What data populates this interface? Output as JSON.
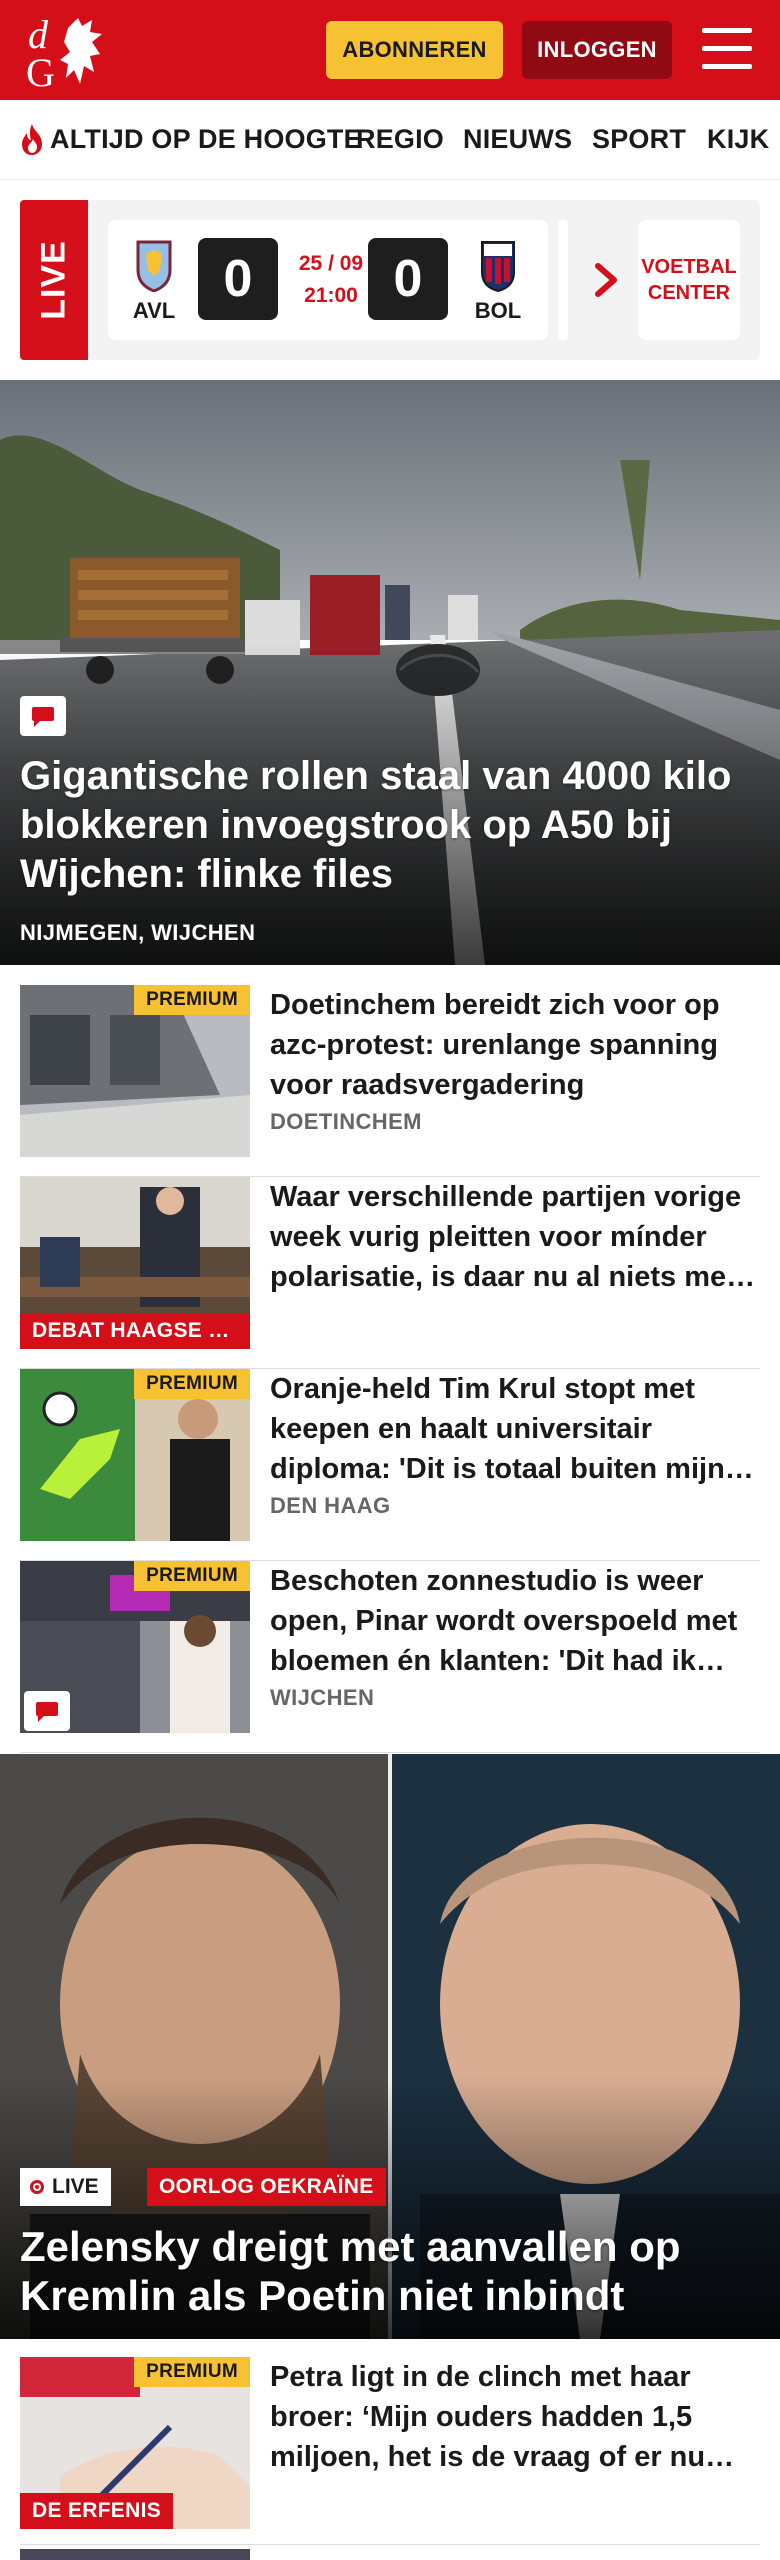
{
  "header": {
    "logo_text": "dG",
    "subscribe_label": "ABONNEREN",
    "login_label": "INLOGGEN",
    "brand_color": "#d50f1a",
    "accent_color": "#f6c234"
  },
  "nav": {
    "items": [
      {
        "label": "ALTIJD OP DE HOOGTE",
        "icon": "fire-icon"
      },
      {
        "label": "REGIO"
      },
      {
        "label": "NIEUWS"
      },
      {
        "label": "SPORT"
      },
      {
        "label": "KIJK"
      }
    ]
  },
  "live": {
    "tag": "LIVE",
    "match": {
      "home_abbr": "AVL",
      "home_score": "0",
      "date": "25 / 09",
      "time": "21:00",
      "away_score": "0",
      "away_abbr": "BOL"
    },
    "voetbal_center": "VOETBAL CENTER"
  },
  "hero": {
    "title": "Gigantische rollen staal van 4000 kilo blokkeren invoegstrook op A50 bij Wijchen: flinke files",
    "location": "NIJMEGEN, WIJCHEN",
    "icon": "comment-icon"
  },
  "articles": [
    {
      "title": "Doetinchem bereidt zich voor op azc-protest: urenlange spanning voor raadsvergadering",
      "location": "DOETINCHEM",
      "badge": "PREMIUM",
      "tag": ""
    },
    {
      "title": "Waar verschillende partijen vorige week vurig pleitten voor mínder polarisatie, is daar nu al niets meer van over",
      "location": "",
      "badge": "",
      "tag": "DEBAT HAAGSE R..."
    },
    {
      "title": "Oranje-held Tim Krul stopt met keepen en haalt universitair diploma: 'Dit is totaal buiten mijn comfortzone'",
      "location": "DEN HAAG",
      "badge": "PREMIUM",
      "tag": ""
    },
    {
      "title": "Beschoten zonnestudio is weer open, Pinar wordt overspoeld met bloemen én klanten: 'Dit had ik nooit verwacht'",
      "location": "WIJCHEN",
      "badge": "PREMIUM",
      "tag": ""
    }
  ],
  "feature": {
    "live_label": "LIVE",
    "tag": "OORLOG OEKRAÏNE",
    "title": "Zelensky dreigt met aanvallen op Kremlin als Poetin niet inbindt"
  },
  "article_last": {
    "title": "Petra ligt in de clinch met haar broer: ‘Mijn ouders hadden 1,5 miljoen, het is de vraag of er nu nog iets over is’",
    "badge": "PREMIUM",
    "tag": "DE ERFENIS"
  }
}
